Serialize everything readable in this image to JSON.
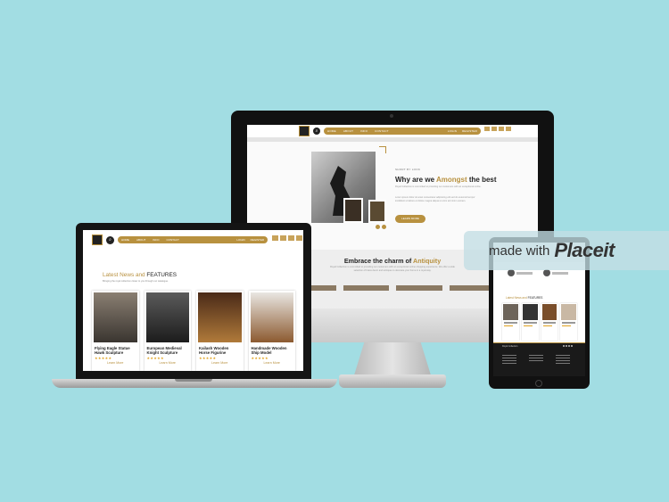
{
  "desktop": {
    "nav": {
      "links": [
        "HOME",
        "ABOUT",
        "INFO",
        "CONTACT"
      ],
      "right_links": [
        "LOGIN",
        "REGISTER"
      ]
    },
    "about": {
      "eyebrow": "SHORT BY LOOK",
      "title_prefix": "Why are we ",
      "title_highlight": "Amongst",
      "title_suffix": " the best",
      "paragraph1": "Royal Collection is committed to providing our customers with an exceptional online.",
      "paragraph2": "Lorem ipsum dolor sit amet consectetur adipiscing elit sed do eiusmod tempor incididunt ut labore et dolore magna aliqua ut enim ad minim veniam.",
      "button": "LEARN MORE"
    },
    "charm": {
      "title_prefix": "Embrace the charm of ",
      "title_highlight": "Antiquity",
      "paragraph": "Royal Collection is committed to providing our customers with an exceptional online shopping experience. We offer a wide selection of brass decor and antiques to decorate your home in a royal way."
    }
  },
  "laptop": {
    "nav": {
      "links": [
        "HOME",
        "ABOUT",
        "INFO",
        "CONTACT"
      ],
      "right_links": [
        "LOGIN",
        "REGISTER"
      ]
    },
    "news": {
      "title_highlight": "Latest News and",
      "title_rest": " FEATURES",
      "subtitle": "Bringing the royal collection closer to you through our catalogue."
    },
    "products": [
      {
        "name": "Flying Eagle Statue Hawk Sculpture",
        "stars": "★★★★★",
        "cta": "Learn More",
        "color_top": "#8a7f72",
        "color_bottom": "#3a3530"
      },
      {
        "name": "European Medieval Knight Sculpture",
        "stars": "★★★★★",
        "cta": "Learn More",
        "color_top": "#5b5b5b",
        "color_bottom": "#1c1c1c"
      },
      {
        "name": "Kailash Wooden Horse Figurine",
        "stars": "★★★★★",
        "cta": "Learn More",
        "color_top": "#4a2a18",
        "color_bottom": "#b07a3a"
      },
      {
        "name": "Handmade Wooden Ship Model",
        "stars": "★★★★★",
        "cta": "Learn More",
        "color_top": "#e9e6e2",
        "color_bottom": "#8c5a30"
      }
    ]
  },
  "tablet": {
    "news": {
      "title_highlight": "Latest News and",
      "title_rest": " FEATURES"
    },
    "footer_title": "Royal Collection"
  },
  "watermark": {
    "prefix": "made with",
    "brand": "Placeit"
  },
  "colors": {
    "background": "#a2dde3",
    "gold": "#b8913f"
  }
}
